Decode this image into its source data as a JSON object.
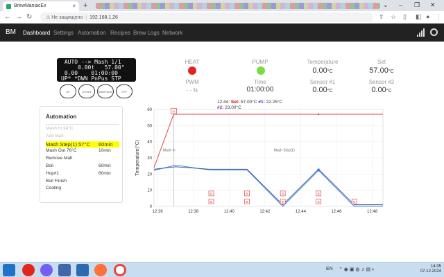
{
  "browser": {
    "tab_title": "BrewManiacEx",
    "address": "192.168.1.26",
    "security": "Не защищено",
    "new_tab": "+",
    "close_tab": "×"
  },
  "nav": {
    "brand": "BM",
    "items": [
      "Dashboard",
      "Settings",
      "Automation",
      "Recipes",
      "Brew Logs",
      "Network"
    ]
  },
  "lcd": {
    "lines": [
      " AUTO --> Mash 1/1 ",
      "     0.00t   57.00°",
      " 0.00    01:00:00 ",
      "UP* *DWN PnPus STP "
    ]
  },
  "buttons": [
    "UP",
    "DOWN",
    "Start/Pause",
    "STP"
  ],
  "status": {
    "heat_label": "HEAT",
    "pump_label": "PUMP",
    "pwm_label": "PWM",
    "pwm_value": "- - %",
    "temperature_label": "Temperature",
    "temperature_value": "0.00",
    "set_label": "Set",
    "set_value": "57.00",
    "time_label": "Time",
    "time_value": "01:00:00",
    "sensor1_label": "Sensor #1",
    "sensor1_value": "0.00",
    "sensor2_label": "Sensor #2",
    "sensor2_value": "0.00",
    "unit": "°C",
    "heat_color": "#e52222",
    "pump_color": "#7ddc3d"
  },
  "automation": {
    "title": "Automation",
    "steps": [
      {
        "name": "Mash In 24°C",
        "time": "",
        "state": "done"
      },
      {
        "name": "Add Malt",
        "time": "",
        "state": "done"
      },
      {
        "name": "Mash Step(1) 57°C",
        "time": "60min",
        "state": "current"
      },
      {
        "name": "Mash Out 76°C",
        "time": "10min",
        "state": "pending"
      },
      {
        "name": "Remove Malt",
        "time": "",
        "state": "pending"
      },
      {
        "name": "Boil",
        "time": "60min",
        "state": "pending"
      },
      {
        "name": "Hop#1",
        "time": "60min",
        "state": "pending"
      },
      {
        "name": "Boil Finish",
        "time": "",
        "state": "pending"
      },
      {
        "name": "Cooling",
        "time": "",
        "state": "pending"
      }
    ]
  },
  "chart_legend": {
    "time": "12:44:",
    "set_label": "Set:",
    "set_value": "57.00°C",
    "s1_label": "#1:",
    "s1_value": "22.25°C",
    "s2_label": "#2:",
    "s2_value": "23.00°C"
  },
  "chart_data": {
    "type": "line",
    "ylabel": "Temperature(°C)",
    "xlabel": "",
    "ylim": [
      0,
      60
    ],
    "yticks": [
      0,
      10,
      20,
      30,
      40,
      50,
      60
    ],
    "xticks": [
      "12:36",
      "12:38",
      "12:40",
      "12:42",
      "12:44",
      "12:46",
      "12:48"
    ],
    "xlim_minutes": [
      -0.2,
      12.6
    ],
    "annotations": [
      {
        "label": "Mash In",
        "x": 0.3
      },
      {
        "label": "Mash Step(1)",
        "x": 6.5
      }
    ],
    "step_marker": {
      "label": "St",
      "x": 0.9,
      "y": 59
    },
    "event_markers": [
      {
        "label": "B",
        "x": 3,
        "y": [
          8,
          3
        ]
      },
      {
        "label": "B",
        "x": 5,
        "y": [
          8,
          3
        ]
      },
      {
        "label": "B",
        "x": 7,
        "y": [
          8,
          3
        ]
      },
      {
        "label": "B",
        "x": 9,
        "y": [
          8,
          3
        ]
      },
      {
        "label": "B",
        "x": 11,
        "y": [
          3
        ]
      }
    ],
    "series": [
      {
        "name": "Set",
        "color": "#e04040",
        "x": [
          -0.2,
          0.9,
          12.6
        ],
        "y": [
          24,
          57,
          57
        ]
      },
      {
        "name": "#1",
        "color": "#4a86d8",
        "x": [
          -0.2,
          1.0,
          2.9,
          5.0,
          7.0,
          9.0,
          11.0,
          12.6
        ],
        "y": [
          22.25,
          25.5,
          22.5,
          22.5,
          0,
          22.25,
          0,
          0
        ]
      },
      {
        "name": "#2",
        "color": "#3a5fa8",
        "x": [
          -0.2,
          1.0,
          2.9,
          5.0,
          7.0,
          9.0,
          11.0,
          12.6
        ],
        "y": [
          23,
          24.5,
          23,
          23,
          1,
          23,
          1,
          1
        ]
      }
    ]
  },
  "taskbar": {
    "time": "14:05",
    "date": "07.12.2024",
    "lang": "EN"
  }
}
